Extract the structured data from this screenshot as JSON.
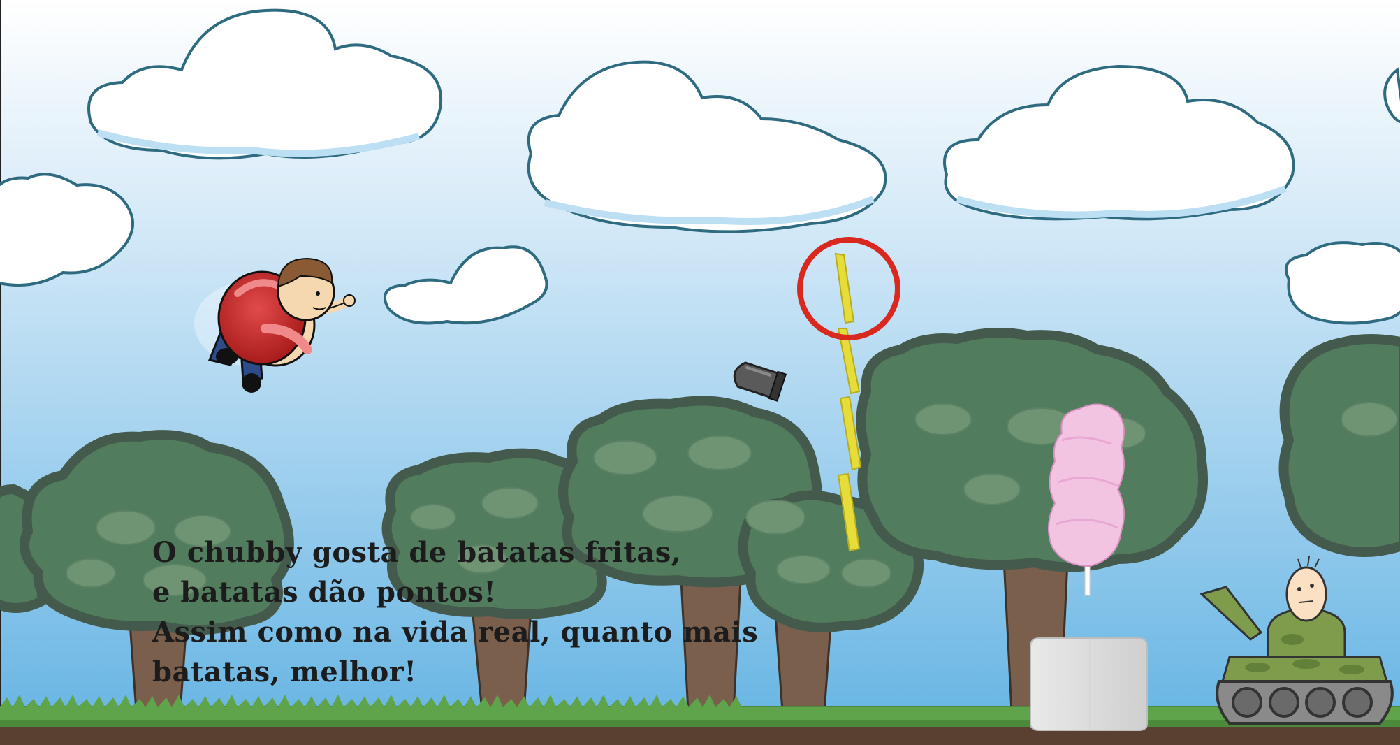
{
  "tutorial": {
    "line1": "O chubby gosta de batatas fritas,",
    "line2": "e batatas dão pontos!",
    "line3": "Assim como na vida real, quanto mais",
    "line4": "batatas, melhor!"
  },
  "colors": {
    "sky_top": "#ffffff",
    "sky_bottom": "#63b3e3",
    "cloud": "#ffffff",
    "cloud_outline": "#2e6b80",
    "tree_canopy": "#527c5e",
    "tree_trunk": "#7a5f4c",
    "grass": "#4a8a3a",
    "ground": "#5a4030",
    "fry_yellow": "#e6dd3a",
    "highlight_ring": "#d9281e",
    "cotton_candy": "#f3c3e2",
    "tank_green": "#7f9b4c"
  },
  "icons": {
    "player": "chubby-character",
    "projectile": "bullet",
    "pickup": "french-fries",
    "obstacle": "cotton-candy",
    "block": "sugar-cube",
    "enemy": "tank"
  }
}
